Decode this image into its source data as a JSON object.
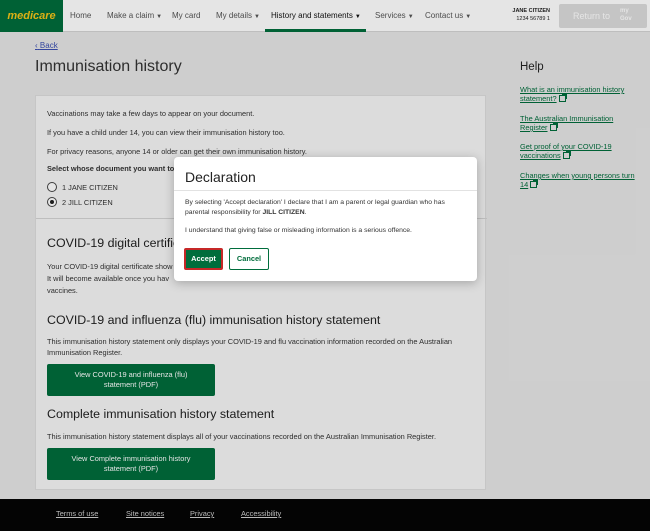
{
  "header": {
    "logo": "medicare",
    "nav": [
      {
        "label": "Home",
        "caret": false
      },
      {
        "label": "Make a claim",
        "caret": true
      },
      {
        "label": "My card",
        "caret": false
      },
      {
        "label": "My details",
        "caret": true
      },
      {
        "label": "History and statements",
        "caret": true
      },
      {
        "label": "Services",
        "caret": true
      },
      {
        "label": "Contact us",
        "caret": true
      }
    ],
    "active_nav": "History and statements",
    "user_name": "JANE CITIZEN",
    "user_number": "1234 56789 1",
    "return_label": "Return to",
    "return_brand_line1": "my",
    "return_brand_line2": "Gov"
  },
  "main": {
    "back_label": "Back",
    "title": "Immunisation history",
    "intro": [
      "Vaccinations may take a few days to appear on your document.",
      "If you have a child under 14, you can view their immunisation history too.",
      "For privacy reasons, anyone 14 or older can get their own immunisation history."
    ],
    "select_label": "Select whose document you want to",
    "people": [
      {
        "label": "1 JANE CITIZEN",
        "checked": false
      },
      {
        "label": "2 JILL CITIZEN",
        "checked": true
      }
    ],
    "covid_cert": {
      "heading": "COVID-19 digital certificat",
      "lines": [
        "Your COVID-19 digital certificate show",
        "It will become available once you hav",
        "vaccines."
      ]
    },
    "flu_statement": {
      "heading": "COVID-19 and influenza (flu) immunisation history statement",
      "lines": [
        "This immunisation history statement only displays your COVID-19 and flu vaccination information recorded on the Australian",
        "Immunisation Register."
      ],
      "button_line1": "View COVID-19 and influenza (flu)",
      "button_line2": "statement (PDF)"
    },
    "complete_statement": {
      "heading": "Complete immunisation history statement",
      "line": "This immunisation history statement displays all of your vaccinations recorded on the Australian Immunisation Register.",
      "button_line1": "View Complete immunisation history",
      "button_line2": "statement (PDF)"
    }
  },
  "help": {
    "title": "Help",
    "links": [
      {
        "line1": "What is an immunisation history",
        "line2": "statement?"
      },
      {
        "line1": "The Australian Immunisation",
        "line2": "Register"
      },
      {
        "line1": "Get proof of your COVID-19",
        "line2": "vaccinations"
      },
      {
        "line1": "Changes when young persons turn",
        "line2": "14"
      }
    ]
  },
  "footer": {
    "links": [
      "Terms of use",
      "Site notices",
      "Privacy",
      "Accessibility"
    ]
  },
  "modal": {
    "title": "Declaration",
    "text1_pre": "By selecting 'Accept declaration' I declare that I am a parent or legal guardian who has parental responsibility for ",
    "text1_name": "JILL CITIZEN",
    "text1_post": ".",
    "text2": "I understand that giving false or misleading information is a serious offence.",
    "accept_label": "Accept",
    "cancel_label": "Cancel"
  },
  "colors": {
    "brand_green": "#006d3c",
    "logo_yellow": "#f5c518",
    "link_blue": "#3a4fb0",
    "focus_red": "#c62828",
    "footer_bg": "#050505"
  }
}
